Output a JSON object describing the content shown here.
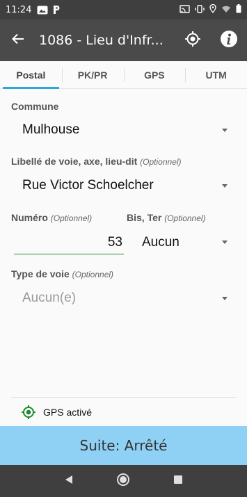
{
  "status_bar": {
    "time": "11:24",
    "icons": [
      "gallery-icon",
      "p-app-icon",
      "cast-icon",
      "vibrate-icon",
      "location-icon",
      "wifi-icon",
      "battery-icon"
    ]
  },
  "app_bar": {
    "title": "1086 - Lieu d'Infr...",
    "back_icon": "arrow-left-icon",
    "actions": [
      "gps-target-icon",
      "info-icon"
    ]
  },
  "tabs": [
    {
      "label": "Postal",
      "active": true
    },
    {
      "label": "PK/PR",
      "active": false
    },
    {
      "label": "GPS",
      "active": false
    },
    {
      "label": "UTM",
      "active": false
    }
  ],
  "form": {
    "commune": {
      "label": "Commune",
      "value": "Mulhouse"
    },
    "libelle": {
      "label": "Libellé de voie, axe, lieu-dit",
      "optional": "(Optionnel)",
      "value": "Rue Victor Schoelcher"
    },
    "numero": {
      "label": "Numéro",
      "optional": "(Optionnel)",
      "value": "53"
    },
    "bister": {
      "label": "Bis, Ter",
      "optional": "(Optionnel)",
      "value": "Aucun"
    },
    "type_voie": {
      "label": "Type de voie",
      "optional": "(Optionnel)",
      "value": "Aucun(e)"
    }
  },
  "gps_status": {
    "text": "GPS activé",
    "color": "#1a8a2e"
  },
  "suite_button": {
    "label": "Suite: Arrêté",
    "color": "#8fd1f5"
  },
  "nav": [
    "back-triangle-icon",
    "home-circle-icon",
    "recents-square-icon"
  ]
}
